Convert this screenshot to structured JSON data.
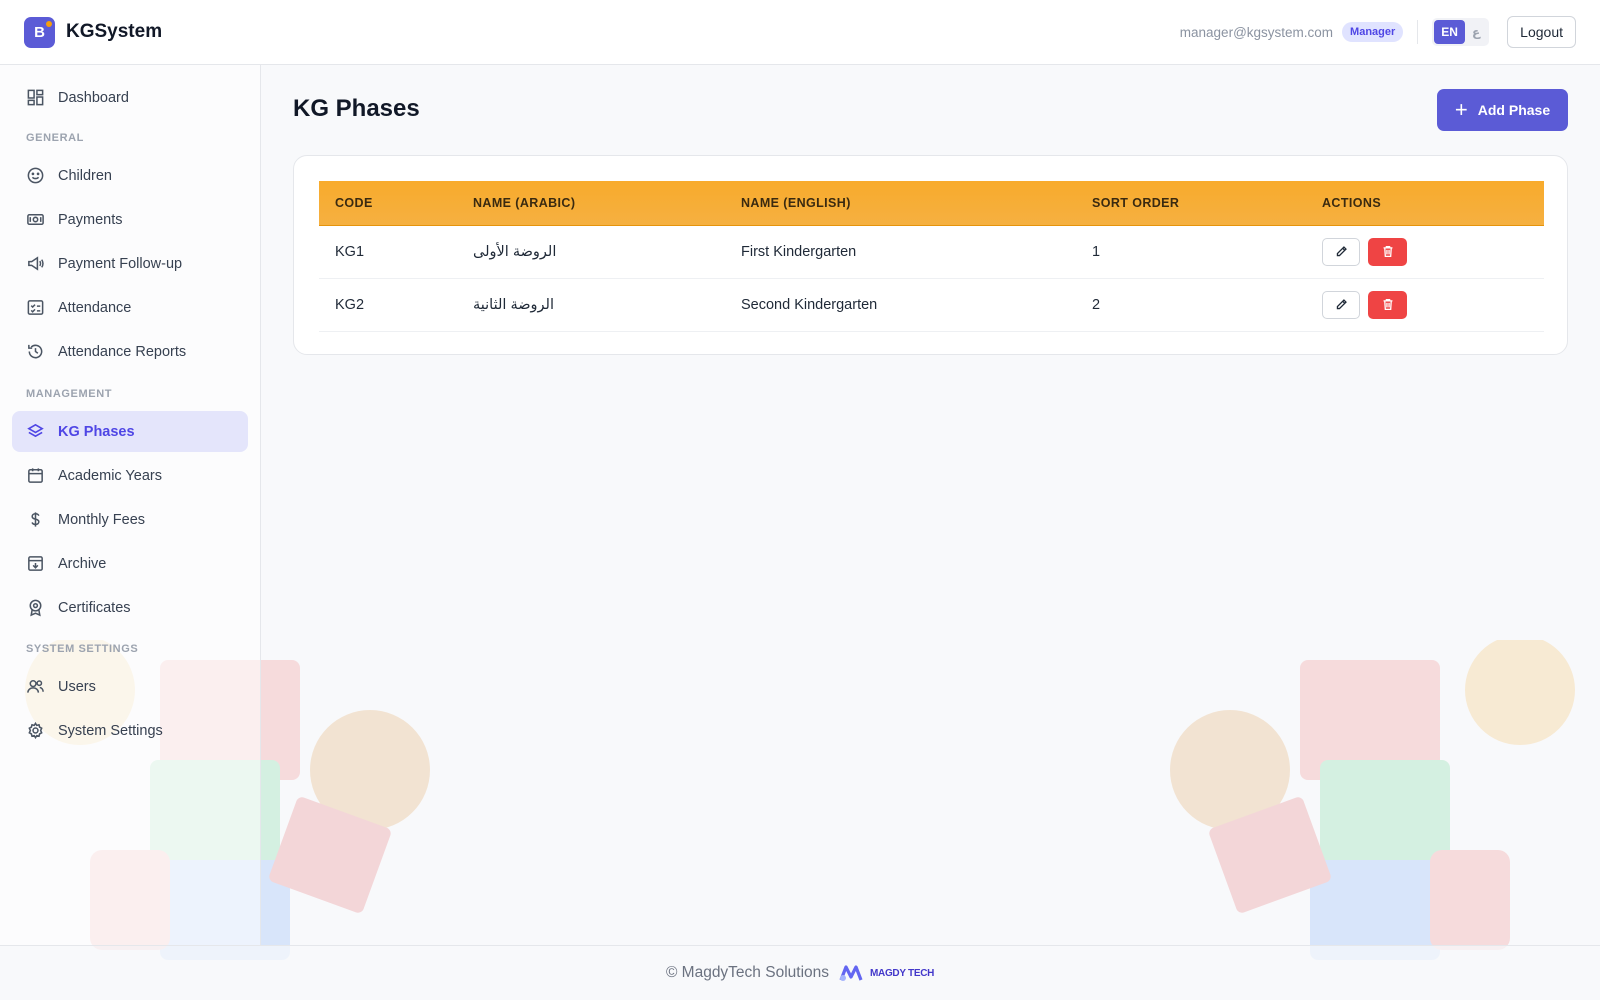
{
  "app": {
    "logo_letter": "B",
    "name": "KGSystem"
  },
  "header": {
    "user_email": "manager@kgsystem.com",
    "role": "Manager",
    "languages": [
      "EN",
      "ع"
    ],
    "active_language": "EN",
    "logout_label": "Logout"
  },
  "sidebar": {
    "dashboard": "Dashboard",
    "sections": {
      "general": "GENERAL",
      "management": "MANAGEMENT",
      "system": "SYSTEM SETTINGS"
    },
    "items": {
      "children": "Children",
      "payments": "Payments",
      "payment_followup": "Payment Follow-up",
      "attendance": "Attendance",
      "attendance_reports": "Attendance Reports",
      "kg_phases": "KG Phases",
      "academic_years": "Academic Years",
      "monthly_fees": "Monthly Fees",
      "archive": "Archive",
      "certificates": "Certificates",
      "users": "Users",
      "system_settings": "System Settings"
    },
    "active_item": "KG Phases"
  },
  "main": {
    "title": "KG Phases",
    "add_button": "Add Phase",
    "table": {
      "headers": [
        "CODE",
        "NAME (ARABIC)",
        "NAME (ENGLISH)",
        "SORT ORDER",
        "ACTIONS"
      ],
      "rows": [
        {
          "code": "KG1",
          "name_ar": "الروضة الأولى",
          "name_en": "First Kindergarten",
          "sort_order": "1"
        },
        {
          "code": "KG2",
          "name_ar": "الروضة الثانية",
          "name_en": "Second Kindergarten",
          "sort_order": "2"
        }
      ]
    }
  },
  "footer": {
    "text": "© MagdyTech Solutions",
    "logo_text": "MAGDY TECH"
  },
  "colors": {
    "accent": "#5b5bd6",
    "table_header": "#f5ab36",
    "delete": "#ef4444",
    "active_nav_bg": "#e4e5fb"
  }
}
